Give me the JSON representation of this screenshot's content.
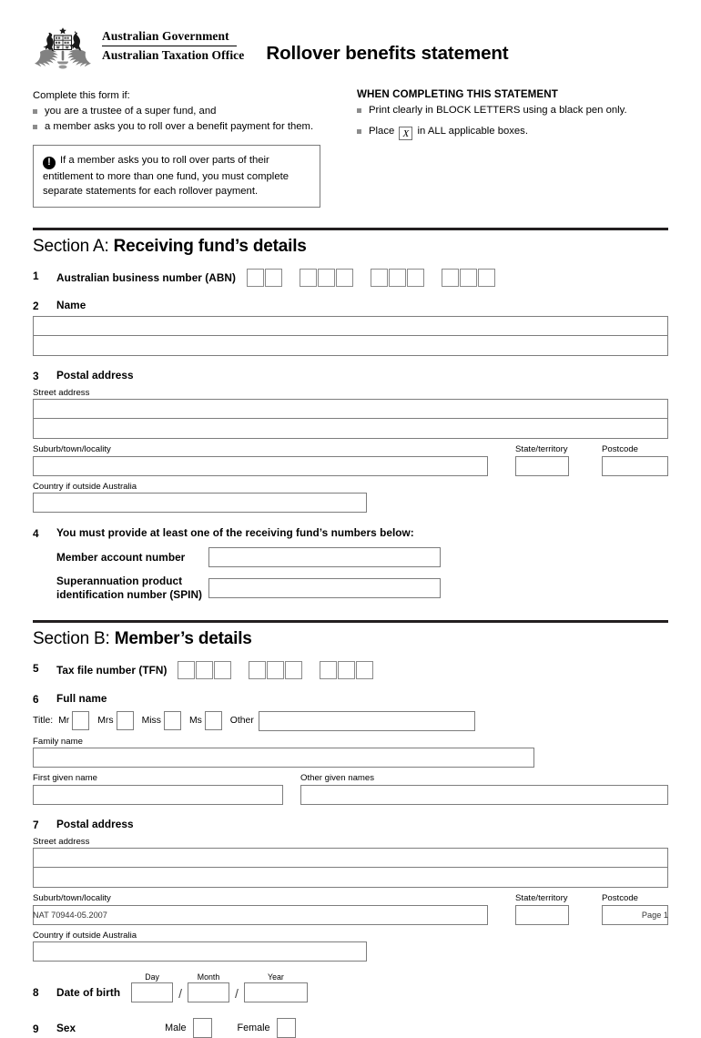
{
  "header": {
    "gov_line1": "Australian Government",
    "gov_line2": "Australian Taxation Office",
    "form_title": "Rollover benefits statement",
    "crest_icon": "commonwealth-coat-of-arms"
  },
  "intro": {
    "complete_if_heading": "Complete this form if:",
    "complete_if_items": [
      "you are a trustee of a super fund, and",
      "a member asks you to roll over a benefit payment for them."
    ],
    "notice_icon": "exclamation-circle-icon",
    "notice_text": "If a member asks you to roll over parts of their entitlement to more than one fund, you must complete separate statements for each rollover payment.",
    "when_heading": "WHEN COMPLETING THIS STATEMENT",
    "when_item_1": "Print clearly in BLOCK LETTERS using a black pen only.",
    "when_item_2_before": "Place",
    "when_item_2_mark": "X",
    "when_item_2_after": "in ALL applicable boxes."
  },
  "section_a": {
    "label": "Section A:",
    "title": "Receiving fund’s details",
    "q1": {
      "num": "1",
      "label": "Australian business number (ABN)",
      "groups": [
        2,
        3,
        3,
        3
      ]
    },
    "q2": {
      "num": "2",
      "label": "Name",
      "rows": 2
    },
    "q3": {
      "num": "3",
      "label": "Postal address",
      "street_label": "Street address",
      "suburb_label": "Suburb/town/locality",
      "state_label": "State/territory",
      "postcode_label": "Postcode",
      "country_label": "Country if outside Australia"
    },
    "q4": {
      "num": "4",
      "label": "You must provide at least one of the receiving fund’s numbers below:",
      "member_account_label": "Member account number",
      "spin_label_line1": "Superannuation product",
      "spin_label_line2": "identification number (SPIN)"
    }
  },
  "section_b": {
    "label": "Section B:",
    "title": "Member’s details",
    "q5": {
      "num": "5",
      "label": "Tax file number (TFN)",
      "groups": [
        3,
        3,
        3
      ]
    },
    "q6": {
      "num": "6",
      "label": "Full name",
      "title_label": "Title:",
      "titles": [
        "Mr",
        "Mrs",
        "Miss",
        "Ms"
      ],
      "other_label": "Other",
      "family_name_label": "Family name",
      "first_given_name_label": "First given name",
      "other_given_names_label": "Other given names"
    },
    "q7": {
      "num": "7",
      "label": "Postal address",
      "street_label": "Street address",
      "suburb_label": "Suburb/town/locality",
      "state_label": "State/territory",
      "postcode_label": "Postcode",
      "country_label": "Country if outside Australia"
    },
    "q8": {
      "num": "8",
      "label": "Date of birth",
      "day_label": "Day",
      "month_label": "Month",
      "year_label": "Year",
      "separator": "/"
    },
    "q9": {
      "num": "9",
      "label": "Sex",
      "male_label": "Male",
      "female_label": "Female"
    }
  },
  "footer": {
    "nat_code": "NAT 70944-05.2007",
    "page_label": "Page 1"
  }
}
